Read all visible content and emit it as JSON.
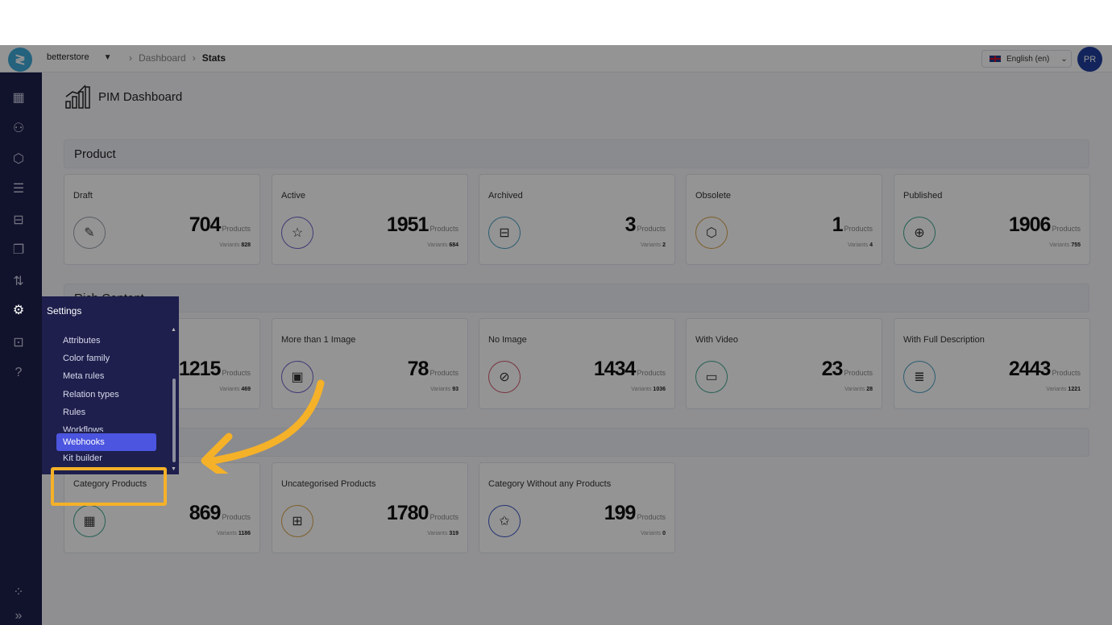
{
  "topbar": {
    "store": "betterstore",
    "breadcrumb": [
      "Dashboard",
      "Stats"
    ],
    "language": "English (en)",
    "avatar_initials": "PR"
  },
  "page": {
    "title": "PIM Dashboard"
  },
  "sections": {
    "product": "Product",
    "rich_content": "Rich Content"
  },
  "product_cards": [
    {
      "label": "Draft",
      "value": "704",
      "unit": "Products",
      "variants_label": "Variants",
      "variants": "828",
      "icon": "draft-icon",
      "color": "#9aa0ac"
    },
    {
      "label": "Active",
      "value": "1951",
      "unit": "Products",
      "variants_label": "Variants",
      "variants": "684",
      "icon": "star-icon",
      "color": "#6b63c9"
    },
    {
      "label": "Archived",
      "value": "3",
      "unit": "Products",
      "variants_label": "Variants",
      "variants": "2",
      "icon": "archive-icon",
      "color": "#4a9fc4"
    },
    {
      "label": "Obsolete",
      "value": "1",
      "unit": "Products",
      "variants_label": "Variants",
      "variants": "4",
      "icon": "box-icon",
      "color": "#d9a24a"
    },
    {
      "label": "Published",
      "value": "1906",
      "unit": "Products",
      "variants_label": "Variants",
      "variants": "755",
      "icon": "published-icon",
      "color": "#3ea58f"
    }
  ],
  "rich_cards": [
    {
      "label": "",
      "value": "1215",
      "unit": "Products",
      "variants_label": "Variants",
      "variants": "469"
    },
    {
      "label": "More than 1 Image",
      "value": "78",
      "unit": "Products",
      "variants_label": "Variants",
      "variants": "93",
      "icon": "images-icon",
      "color": "#6b63c9"
    },
    {
      "label": "No Image",
      "value": "1434",
      "unit": "Products",
      "variants_label": "Variants",
      "variants": "1036",
      "icon": "no-image-icon",
      "color": "#d05a6e"
    },
    {
      "label": "With Video",
      "value": "23",
      "unit": "Products",
      "variants_label": "Variants",
      "variants": "28",
      "icon": "video-icon",
      "color": "#3ea58f"
    },
    {
      "label": "With Full Description",
      "value": "2443",
      "unit": "Products",
      "variants_label": "Variants",
      "variants": "1221",
      "icon": "description-icon",
      "color": "#4a9fc4"
    }
  ],
  "category_cards": [
    {
      "label": "Category Products",
      "value": "869",
      "unit": "Products",
      "variants_label": "Variants",
      "variants": "1186",
      "icon": "grid-icon",
      "color": "#3ea58f"
    },
    {
      "label": "Uncategorised Products",
      "value": "1780",
      "unit": "Products",
      "variants_label": "Variants",
      "variants": "319",
      "icon": "grid-search-icon",
      "color": "#d9a24a"
    },
    {
      "label": "Category Without any Products",
      "value": "199",
      "unit": "Products",
      "variants_label": "Variants",
      "variants": "0",
      "icon": "star-outline-icon",
      "color": "#3f59c4"
    }
  ],
  "settings_menu": {
    "title": "Settings",
    "items": [
      "Attributes",
      "Color family",
      "Meta rules",
      "Relation types",
      "Rules",
      "Workflows"
    ],
    "active": "Webhooks",
    "after": "Kit builder"
  },
  "colors": {
    "sidebar": "#1e1f4d",
    "accent": "#4b55e0",
    "highlight": "#f5b128"
  }
}
